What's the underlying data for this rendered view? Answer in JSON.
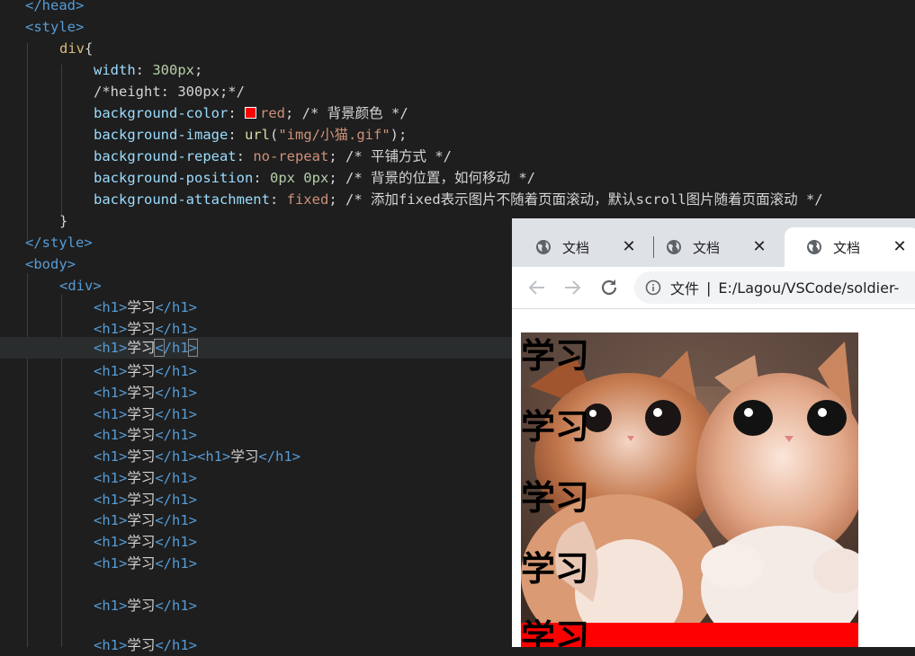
{
  "editor": {
    "lines": [
      {
        "text_head": "</head>"
      },
      {
        "text_style_open": "<style>"
      },
      {
        "selector": "div",
        "brace_open": "{"
      },
      {
        "prop": "width",
        "value": "300px",
        "semi": ";"
      },
      {
        "comment": "/*height: 300px;*/"
      },
      {
        "prop": "background-color",
        "value": "red",
        "semi": ";",
        "comment": "/* 背景颜色 */"
      },
      {
        "prop": "background-image",
        "fn": "url",
        "str": "\"img/小猫.gif\"",
        "close": ");"
      },
      {
        "prop": "background-repeat",
        "value": "no-repeat",
        "semi": ";",
        "comment": "/* 平铺方式 */"
      },
      {
        "prop": "background-position",
        "value": "0px 0px",
        "semi": ";",
        "comment": "/* 背景的位置，如何移动 */"
      },
      {
        "prop": "background-attachment",
        "value": "fixed",
        "semi": ";",
        "comment": "/* 添加fixed表示图片不随着页面滚动，默认scroll图片随着页面滚动 */"
      },
      {
        "brace_close": "}"
      },
      {
        "text_style_close": "</style>"
      },
      {
        "text_body": "<body>"
      },
      {
        "text_div": "<div>"
      }
    ],
    "h1_open": "<h1>",
    "h1_close": "</h1>",
    "h1_text": "学习",
    "h1_close_lt": "<",
    "h1_close_rest": "/h1",
    "h1_close_gt": ">",
    "colon": ": "
  },
  "browser": {
    "tabs": [
      {
        "title": "文档",
        "close": "✕"
      },
      {
        "title": "文档",
        "close": "✕"
      },
      {
        "title": "文档",
        "close": "✕"
      }
    ],
    "omnibox": {
      "scheme_label": "文件",
      "separator": "|",
      "url": "E:/Lagou/VSCode/soldier-"
    },
    "page_headings": [
      "学习",
      "学习",
      "学习",
      "学习",
      "学习"
    ],
    "colors": {
      "div_background": "#ff0000"
    }
  }
}
